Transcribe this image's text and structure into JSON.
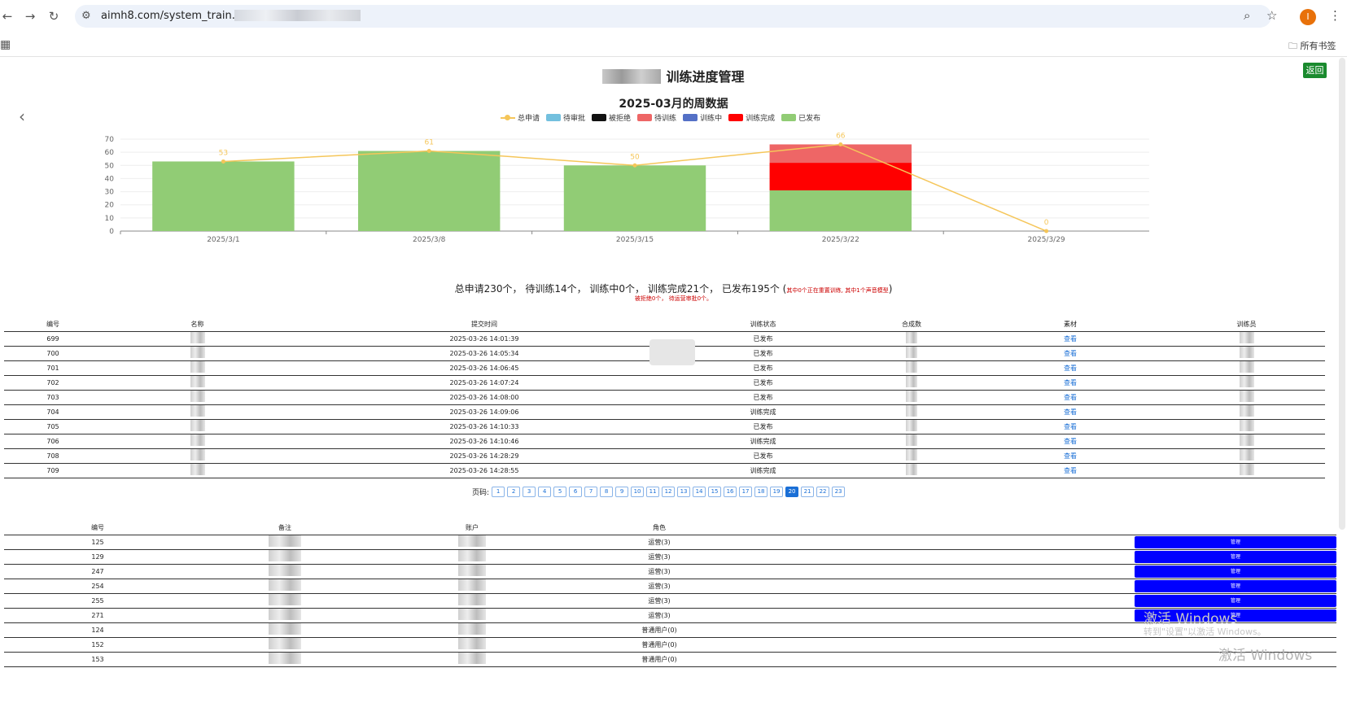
{
  "browser": {
    "url": "aimh8.com/system_train.htm",
    "bookmarks_all": "所有书签",
    "profile_initial": "I"
  },
  "page": {
    "title": "训练进度管理",
    "back_label": "返回"
  },
  "chart_data": {
    "type": "bar",
    "title": "2025-03月的周数据",
    "categories": [
      "2025/3/1",
      "2025/3/8",
      "2025/3/15",
      "2025/3/22",
      "2025/3/29"
    ],
    "ylim": [
      0,
      70
    ],
    "yticks": [
      0,
      10,
      20,
      30,
      40,
      50,
      60,
      70
    ],
    "legend": [
      "总申请",
      "待审批",
      "被拒绝",
      "待训练",
      "训练中",
      "训练完成",
      "已发布"
    ],
    "legend_colors": [
      "#f5c65a",
      "#73c0de",
      "#111111",
      "#ee6666",
      "#5470c6",
      "#ff0000",
      "#91cc75"
    ],
    "line_series": {
      "name": "总申请",
      "color": "#f5c65a",
      "values": [
        53,
        61,
        50,
        66,
        0
      ]
    },
    "stacked_series": [
      {
        "name": "已发布",
        "color": "#91cc75",
        "values": [
          53,
          61,
          50,
          31,
          0
        ]
      },
      {
        "name": "训练完成",
        "color": "#ff0000",
        "values": [
          0,
          0,
          0,
          21,
          0
        ]
      },
      {
        "name": "待训练",
        "color": "#ee6666",
        "values": [
          0,
          0,
          0,
          14,
          0
        ]
      }
    ]
  },
  "summary": {
    "main": "总申请230个， 待训练14个， 训练中0个， 训练完成21个， 已发布195个 (",
    "note": "其中0个正在重置训练, 其中1个声音模型",
    "close": ")",
    "line2": "被拒绝0个，  待运营审批0个。"
  },
  "table1": {
    "headers": [
      "编号",
      "名称",
      "提交时间",
      "训练状态",
      "合成数",
      "素材",
      "训练员"
    ],
    "view_label": "查看",
    "rows": [
      {
        "id": "699",
        "time": "2025-03-26 14:01:39",
        "status": "已发布"
      },
      {
        "id": "700",
        "time": "2025-03-26 14:05:34",
        "status": "已发布"
      },
      {
        "id": "701",
        "time": "2025-03-26 14:06:45",
        "status": "已发布"
      },
      {
        "id": "702",
        "time": "2025-03-26 14:07:24",
        "status": "已发布"
      },
      {
        "id": "703",
        "time": "2025-03-26 14:08:00",
        "status": "已发布"
      },
      {
        "id": "704",
        "time": "2025-03-26 14:09:06",
        "status": "训练完成"
      },
      {
        "id": "705",
        "time": "2025-03-26 14:10:33",
        "status": "已发布"
      },
      {
        "id": "706",
        "time": "2025-03-26 14:10:46",
        "status": "训练完成"
      },
      {
        "id": "708",
        "time": "2025-03-26 14:28:29",
        "status": "已发布"
      },
      {
        "id": "709",
        "time": "2025-03-26 14:28:55",
        "status": "训练完成"
      }
    ]
  },
  "pager": {
    "label": "页码:",
    "pages": [
      "1",
      "2",
      "3",
      "4",
      "5",
      "6",
      "7",
      "8",
      "9",
      "10",
      "11",
      "12",
      "13",
      "14",
      "15",
      "16",
      "17",
      "18",
      "19",
      "20",
      "21",
      "22",
      "23"
    ],
    "active": "20"
  },
  "table2": {
    "headers": [
      "编号",
      "备注",
      "账户",
      "角色"
    ],
    "manage_label": "管理",
    "rows": [
      {
        "id": "125",
        "role": "运营(3)",
        "manage": true
      },
      {
        "id": "129",
        "role": "运营(3)",
        "manage": true
      },
      {
        "id": "247",
        "role": "运营(3)",
        "manage": true
      },
      {
        "id": "254",
        "role": "运营(3)",
        "manage": true
      },
      {
        "id": "255",
        "role": "运营(3)",
        "manage": true
      },
      {
        "id": "271",
        "role": "运营(3)",
        "manage": true
      },
      {
        "id": "124",
        "role": "普通用户(0)",
        "manage": false
      },
      {
        "id": "152",
        "role": "普通用户(0)",
        "manage": false
      },
      {
        "id": "153",
        "role": "普通用户(0)",
        "manage": false
      }
    ]
  },
  "watermark": {
    "line1": "激活 Windows",
    "line2": "转到\"设置\"以激活 Windows。",
    "line3": "激活 Windows"
  }
}
